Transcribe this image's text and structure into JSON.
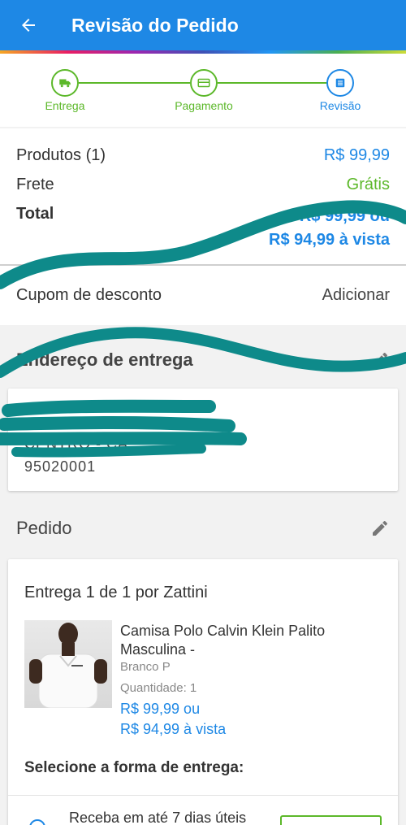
{
  "header": {
    "title": "Revisão do Pedido"
  },
  "stepper": {
    "steps": [
      {
        "label": "Entrega"
      },
      {
        "label": "Pagamento"
      },
      {
        "label": "Revisão"
      }
    ]
  },
  "summary": {
    "products_label": "Produtos (1)",
    "products_value": "R$ 99,99",
    "shipping_label": "Frete",
    "shipping_value": "Grátis",
    "total_label": "Total",
    "total_installment": "R$ 99,99 ou",
    "total_cash": "R$ 94,99 à vista"
  },
  "coupon": {
    "label": "Cupom de desconto",
    "action": "Adicionar"
  },
  "address": {
    "title": "Endereço de entrega",
    "line2": "CENTRO - CA",
    "zip": "95020001"
  },
  "order": {
    "title": "Pedido",
    "delivery_title": "Entrega 1 de 1 por Zattini",
    "product_name": "Camisa Polo Calvin Klein Palito Masculina -",
    "variant": "Branco P",
    "quantity": "Quantidade:  1",
    "price_installment": "R$ 99,99 ou",
    "price_cash": "R$ 94,99 à vista",
    "select_shipping": "Selecione a forma de entrega:",
    "shipping_option": "Receba em até 7 dias úteis"
  },
  "colors": {
    "primary": "#1e88e5",
    "success": "#5cb82a",
    "scribble": "#0e8a8a"
  }
}
